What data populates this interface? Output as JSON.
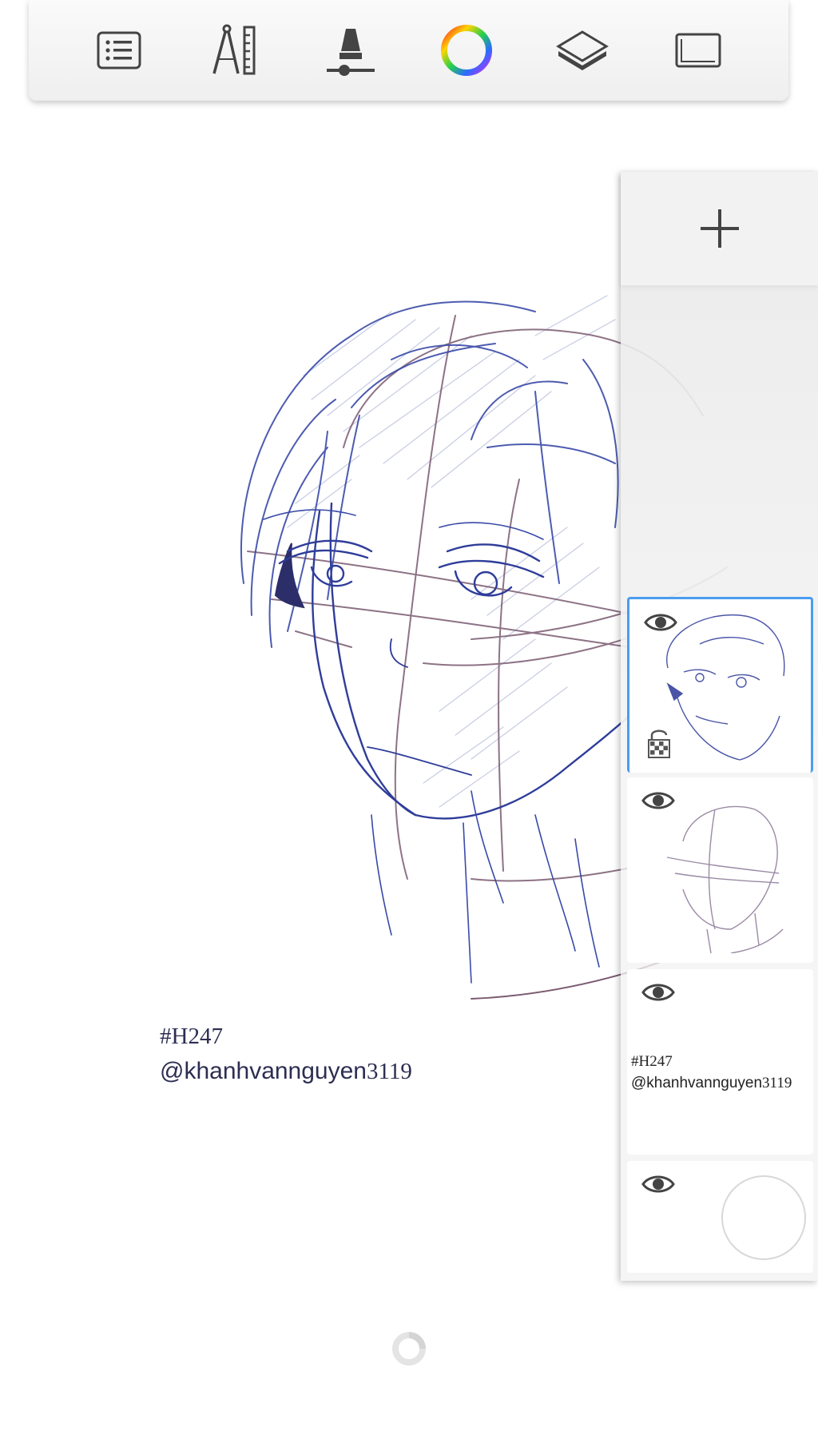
{
  "toolbar": {
    "tools": [
      {
        "name": "list-menu-icon"
      },
      {
        "name": "ruler-compass-icon"
      },
      {
        "name": "brush-size-icon"
      },
      {
        "name": "color-wheel-icon"
      },
      {
        "name": "layers-icon"
      },
      {
        "name": "canvas-frame-icon"
      }
    ]
  },
  "canvas": {
    "watermark": {
      "tag": "#H247",
      "handle_prefix": "@khanhvannguyen",
      "handle_digits": "3119"
    }
  },
  "layers": {
    "add_icon": "plus-icon",
    "items": [
      {
        "visible": true,
        "active": true,
        "locked": false,
        "content": "face-sketch"
      },
      {
        "visible": true,
        "active": false,
        "locked": false,
        "content": "head-guide"
      },
      {
        "visible": true,
        "active": false,
        "locked": false,
        "content": "text",
        "text_tag": "#H247",
        "text_handle_prefix": "@khanhvannguyen",
        "text_handle_digits": "3119"
      },
      {
        "visible": true,
        "active": false,
        "locked": false,
        "content": "empty"
      }
    ]
  },
  "colors": {
    "accent": "#4a9df0",
    "sketch_blue": "#3a4aa8",
    "sketch_mauve": "#7a5a70"
  }
}
